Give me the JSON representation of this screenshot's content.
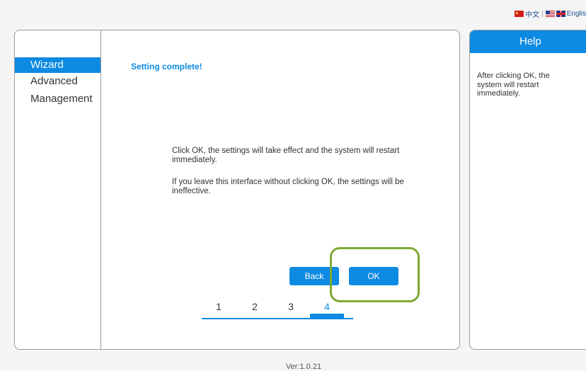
{
  "language_bar": {
    "chinese_label": "中文",
    "separator": "|",
    "english_label": "Englis"
  },
  "sidebar": {
    "items": [
      {
        "label": "Wizard",
        "active": true
      },
      {
        "label": "Advanced",
        "active": false
      },
      {
        "label": "Management",
        "active": false
      }
    ]
  },
  "wizard": {
    "title": "Setting complete!",
    "message_1": "Click OK, the settings will take effect and the system will restart immediately.",
    "message_2": "If you leave this interface without clicking OK, the settings will be ineffective.",
    "back_label": "Back",
    "ok_label": "OK",
    "steps": [
      "1",
      "2",
      "3",
      "4"
    ],
    "current_step": 4
  },
  "help": {
    "title": "Help",
    "text": "After clicking OK, the system will restart immediately."
  },
  "footer": {
    "version": "Ver:1.0.21"
  },
  "colors": {
    "accent": "#0d8ae1",
    "highlight": "#7ea934"
  }
}
